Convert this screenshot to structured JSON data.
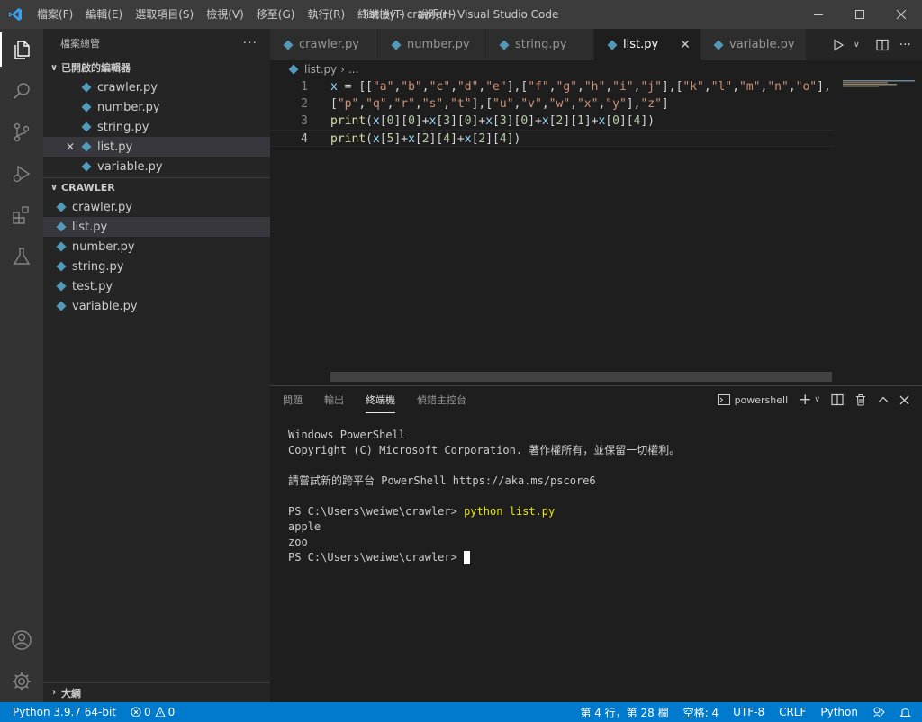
{
  "titlebar": {
    "menu": [
      "檔案(F)",
      "編輯(E)",
      "選取項目(S)",
      "檢視(V)",
      "移至(G)",
      "執行(R)",
      "終端機(T)",
      "說明(H)"
    ],
    "title": "list.py - crawler - Visual Studio Code"
  },
  "sidebar": {
    "header": "檔案總管",
    "open_editors_title": "已開啟的編輯器",
    "open_editors": [
      "crawler.py",
      "number.py",
      "string.py",
      "list.py",
      "variable.py"
    ],
    "folder_title": "CRAWLER",
    "files": [
      "crawler.py",
      "list.py",
      "number.py",
      "string.py",
      "test.py",
      "variable.py"
    ],
    "outline_title": "大綱"
  },
  "tabs": [
    "crawler.py",
    "number.py",
    "string.py",
    "list.py",
    "variable.py"
  ],
  "breadcrumb": {
    "file": "list.py",
    "more": "..."
  },
  "editor": {
    "line_numbers": [
      "1",
      "2",
      "3",
      "4"
    ],
    "lines": [
      "x = [[\"a\",\"b\",\"c\",\"d\",\"e\"],[\"f\",\"g\",\"h\",\"i\",\"j\"],[\"k\",\"l\",\"m\",\"n\",\"o\"],",
      "[\"p\",\"q\",\"r\",\"s\",\"t\"],[\"u\",\"v\",\"w\",\"x\",\"y\"],\"z\"]",
      "print(x[0][0]+x[3][0]+x[3][0]+x[2][1]+x[0][4])",
      "print(x[5]+x[2][4]+x[2][4])"
    ]
  },
  "panel": {
    "tabs": [
      "問題",
      "輸出",
      "終端機",
      "偵錯主控台"
    ],
    "shell": "powershell",
    "terminal": {
      "l1": "Windows PowerShell",
      "l2": "Copyright (C) Microsoft Corporation. 著作權所有，並保留一切權利。",
      "l3": "請嘗試新的跨平台 PowerShell https://aka.ms/pscore6",
      "prompt": "PS C:\\Users\\weiwe\\crawler> ",
      "command": "python list.py",
      "out1": "apple",
      "out2": "zoo",
      "prompt2": "PS C:\\Users\\weiwe\\crawler> "
    }
  },
  "statusbar": {
    "python": "Python 3.9.7 64-bit",
    "errors": "0",
    "warnings": "0",
    "position": "第 4 行，第 28 欄",
    "spaces": "空格: 4",
    "encoding": "UTF-8",
    "eol": "CRLF",
    "language": "Python"
  },
  "colors": {
    "accent": "#007acc",
    "activity": "#333333",
    "sidebar": "#252526",
    "editor": "#1e1e1e"
  }
}
